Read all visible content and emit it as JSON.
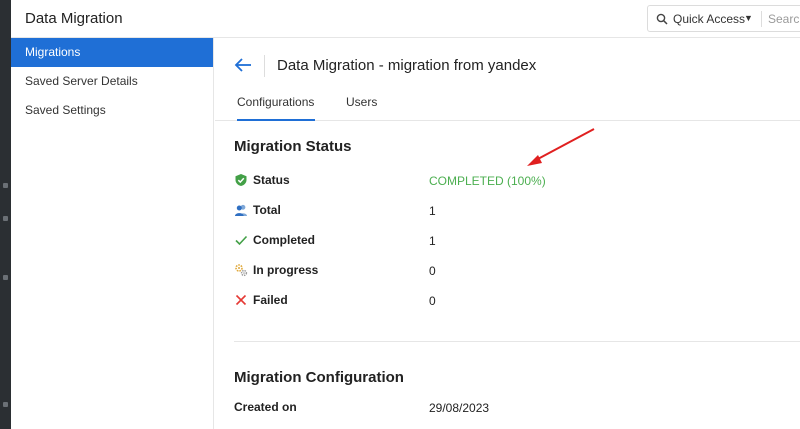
{
  "header": {
    "app_title": "Data Migration",
    "quick_access_label": "Quick Access",
    "search_placeholder": "Search"
  },
  "sidebar": {
    "items": [
      {
        "label": "Migrations",
        "active": true
      },
      {
        "label": "Saved Server Details",
        "active": false
      },
      {
        "label": "Saved Settings",
        "active": false
      }
    ]
  },
  "main": {
    "page_title": "Data Migration - migration from yandex",
    "tabs": [
      {
        "label": "Configurations",
        "active": true
      },
      {
        "label": "Users",
        "active": false
      }
    ],
    "migration_status": {
      "title": "Migration Status",
      "rows": [
        {
          "label": "Status",
          "value": "COMPLETED (100%)",
          "icon": "shield-check-icon"
        },
        {
          "label": "Total",
          "value": "1",
          "icon": "users-icon"
        },
        {
          "label": "Completed",
          "value": "1",
          "icon": "check-icon"
        },
        {
          "label": "In progress",
          "value": "0",
          "icon": "progress-gears-icon"
        },
        {
          "label": "Failed",
          "value": "0",
          "icon": "cross-icon"
        }
      ]
    },
    "migration_configuration": {
      "title": "Migration Configuration",
      "created_on_label": "Created on",
      "created_on_value": "29/08/2023"
    }
  },
  "colors": {
    "accent": "#1f6fd6",
    "success": "#4caf50",
    "danger": "#e53935",
    "annotation": "#e02020"
  }
}
